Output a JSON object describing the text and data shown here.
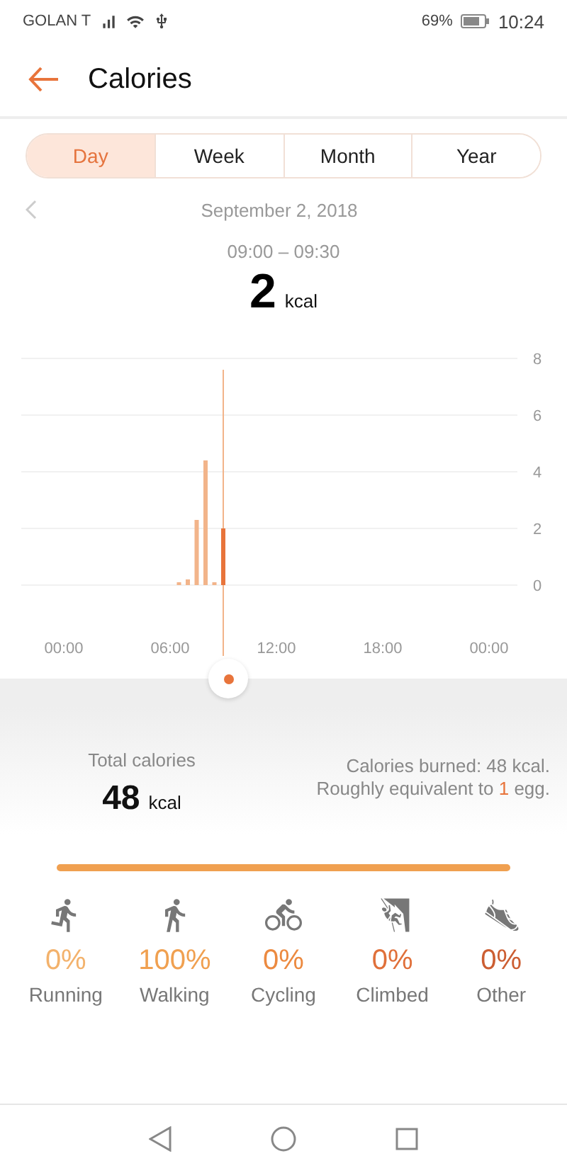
{
  "status_bar": {
    "carrier": "GOLAN T",
    "battery": "69%",
    "time": "10:24"
  },
  "header": {
    "title": "Calories"
  },
  "tabs": [
    {
      "label": "Day",
      "selected": true
    },
    {
      "label": "Week",
      "selected": false
    },
    {
      "label": "Month",
      "selected": false
    },
    {
      "label": "Year",
      "selected": false
    }
  ],
  "date": "September 2, 2018",
  "selection": {
    "range": "09:00 – 09:30",
    "value": "2",
    "unit": "kcal"
  },
  "chart_data": {
    "type": "bar",
    "x": [
      6.5,
      7,
      7.5,
      8,
      8.5,
      9
    ],
    "xlim": [
      0,
      24
    ],
    "ylim": [
      0,
      8
    ],
    "grid": true,
    "values": [
      0.1,
      0.2,
      2.3,
      4.4,
      0.1,
      2
    ],
    "ref_lines": [
      {
        "axis": "x",
        "value": 9
      }
    ],
    "xticks": [
      {
        "value": 0,
        "label": "00:00"
      },
      {
        "value": 6,
        "label": "06:00"
      },
      {
        "value": 12,
        "label": "12:00"
      },
      {
        "value": 18,
        "label": "18:00"
      },
      {
        "value": 24,
        "label": "00:00"
      }
    ],
    "yticks": [
      0,
      2,
      4,
      6,
      8
    ]
  },
  "total": {
    "label": "Total calories",
    "value": "48",
    "unit": "kcal"
  },
  "summary": {
    "burned": "Calories burned: 48 kcal.",
    "before": "Roughly equivalent to ",
    "count": "1",
    "after": " egg."
  },
  "share_bar": {
    "level": 1
  },
  "activities": [
    {
      "kind": "running",
      "percent": "0%",
      "label": "Running",
      "color": "#f3b26c"
    },
    {
      "kind": "walking",
      "percent": "100%",
      "label": "Walking",
      "color": "#f0a050"
    },
    {
      "kind": "cycling",
      "percent": "0%",
      "label": "Cycling",
      "color": "#ec8a40"
    },
    {
      "kind": "climbing",
      "percent": "0%",
      "label": "Climbed",
      "color": "#e0703a"
    },
    {
      "kind": "other",
      "percent": "0%",
      "label": "Other",
      "color": "#cc5e32"
    }
  ]
}
